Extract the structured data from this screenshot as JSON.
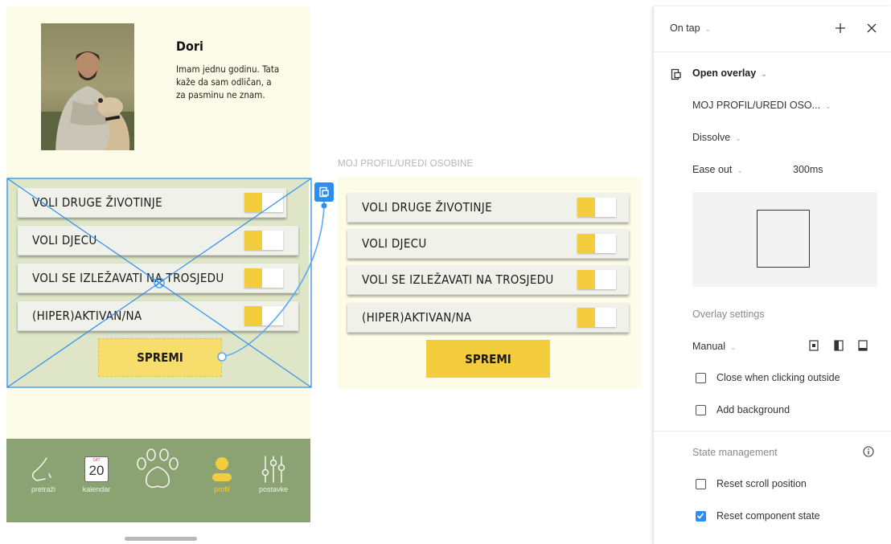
{
  "profile": {
    "name": "Dori",
    "bio": "Imam jednu godinu. Tata kaže da sam odličan, a za pasminu ne znam."
  },
  "toggles": [
    {
      "label": "VOLI DRUGE ŽIVOTINJE",
      "on": true
    },
    {
      "label": "VOLI DJECU",
      "on": true
    },
    {
      "label": "VOLI SE IZLEŽAVATI NA TROSJEDU",
      "on": true
    },
    {
      "label": "(HIPER)AKTIVAN/NA",
      "on": true
    }
  ],
  "save_label": "SPREMI",
  "nav": [
    {
      "label": "pretraži",
      "icon": "nose-icon"
    },
    {
      "label": "kalendar",
      "icon": "calendar-icon",
      "day_name": "SAT",
      "day_number": "20"
    },
    {
      "label": "",
      "icon": "paw-icon"
    },
    {
      "label": "profil",
      "icon": "profile-icon",
      "active": true
    },
    {
      "label": "postavke",
      "icon": "sliders-icon"
    }
  ],
  "overlay_frame": {
    "title": "MOJ PROFIL/UREDI OSOBINE"
  },
  "panel": {
    "trigger": "On tap",
    "action": "Open overlay",
    "destination": "MOJ PROFIL/UREDI OSO...",
    "animation": "Dissolve",
    "easing": "Ease out",
    "duration": "300ms",
    "overlay_settings_title": "Overlay settings",
    "position": "Manual",
    "close_outside": "Close when clicking outside",
    "close_outside_checked": false,
    "add_background": "Add background",
    "add_background_checked": false,
    "state_title": "State management",
    "reset_scroll": "Reset scroll position",
    "reset_scroll_checked": false,
    "reset_component": "Reset component state",
    "reset_component_checked": true
  },
  "colors": {
    "accent_yellow": "#f4cd3e",
    "nav_green": "#8ba372",
    "frame_bg": "#fcfce8",
    "selection_blue": "#2d8ef0"
  }
}
